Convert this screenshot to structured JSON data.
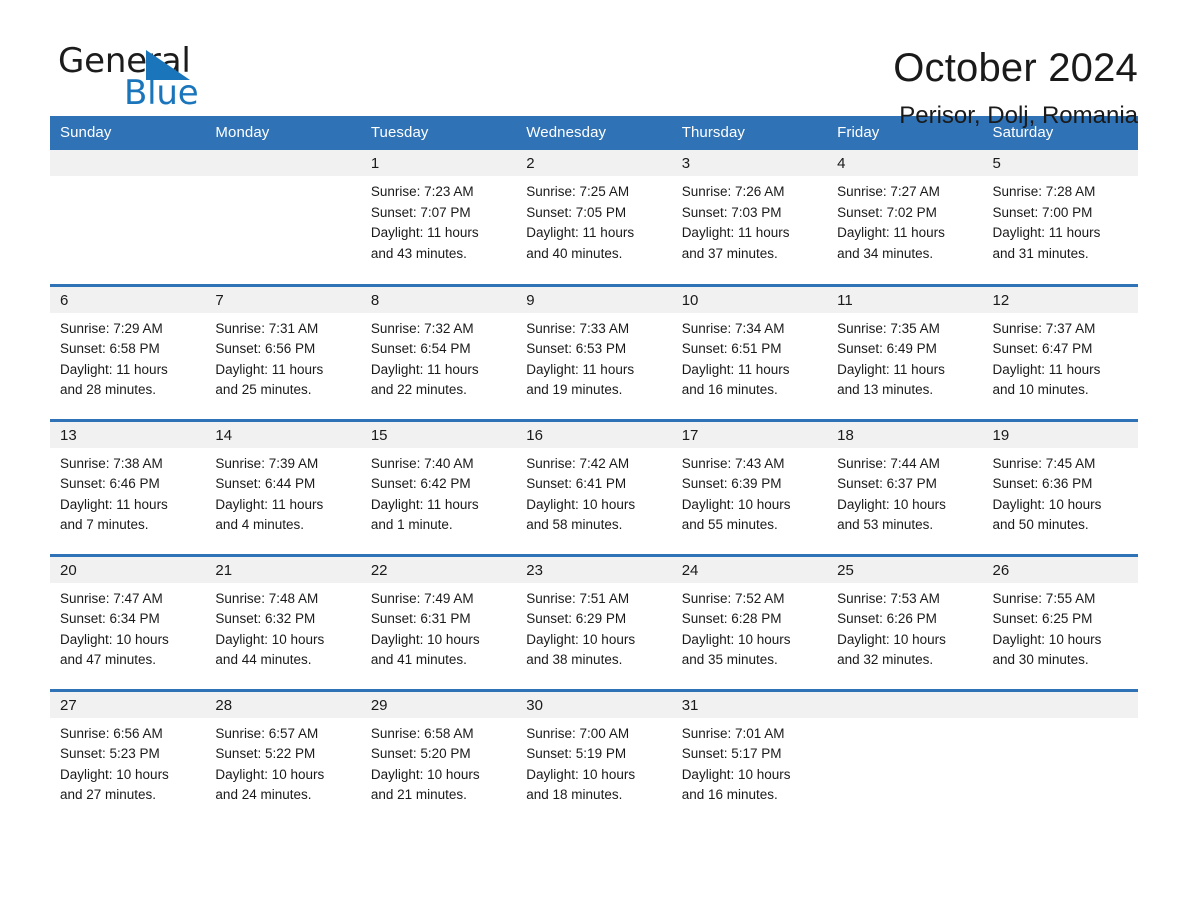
{
  "brand": {
    "name_part1": "General",
    "name_part2": "Blue",
    "logo_icon": "triangle-logo-icon",
    "accent_color": "#1b75bb"
  },
  "header": {
    "title": "October 2024",
    "subtitle": "Perisor, Dolj, Romania",
    "header_bg_color": "#2f72b5",
    "daynum_bg_color": "#f1f1f1"
  },
  "weekday_headers": [
    "Sunday",
    "Monday",
    "Tuesday",
    "Wednesday",
    "Thursday",
    "Friday",
    "Saturday"
  ],
  "labels": {
    "sunrise_prefix": "Sunrise:",
    "sunset_prefix": "Sunset:",
    "daylight_prefix": "Daylight:"
  },
  "weeks": [
    [
      {
        "day": "",
        "sunrise": "",
        "sunset": "",
        "daylight_line1": "",
        "daylight_line2": ""
      },
      {
        "day": "",
        "sunrise": "",
        "sunset": "",
        "daylight_line1": "",
        "daylight_line2": ""
      },
      {
        "day": "1",
        "sunrise": "Sunrise: 7:23 AM",
        "sunset": "Sunset: 7:07 PM",
        "daylight_line1": "Daylight: 11 hours",
        "daylight_line2": "and 43 minutes."
      },
      {
        "day": "2",
        "sunrise": "Sunrise: 7:25 AM",
        "sunset": "Sunset: 7:05 PM",
        "daylight_line1": "Daylight: 11 hours",
        "daylight_line2": "and 40 minutes."
      },
      {
        "day": "3",
        "sunrise": "Sunrise: 7:26 AM",
        "sunset": "Sunset: 7:03 PM",
        "daylight_line1": "Daylight: 11 hours",
        "daylight_line2": "and 37 minutes."
      },
      {
        "day": "4",
        "sunrise": "Sunrise: 7:27 AM",
        "sunset": "Sunset: 7:02 PM",
        "daylight_line1": "Daylight: 11 hours",
        "daylight_line2": "and 34 minutes."
      },
      {
        "day": "5",
        "sunrise": "Sunrise: 7:28 AM",
        "sunset": "Sunset: 7:00 PM",
        "daylight_line1": "Daylight: 11 hours",
        "daylight_line2": "and 31 minutes."
      }
    ],
    [
      {
        "day": "6",
        "sunrise": "Sunrise: 7:29 AM",
        "sunset": "Sunset: 6:58 PM",
        "daylight_line1": "Daylight: 11 hours",
        "daylight_line2": "and 28 minutes."
      },
      {
        "day": "7",
        "sunrise": "Sunrise: 7:31 AM",
        "sunset": "Sunset: 6:56 PM",
        "daylight_line1": "Daylight: 11 hours",
        "daylight_line2": "and 25 minutes."
      },
      {
        "day": "8",
        "sunrise": "Sunrise: 7:32 AM",
        "sunset": "Sunset: 6:54 PM",
        "daylight_line1": "Daylight: 11 hours",
        "daylight_line2": "and 22 minutes."
      },
      {
        "day": "9",
        "sunrise": "Sunrise: 7:33 AM",
        "sunset": "Sunset: 6:53 PM",
        "daylight_line1": "Daylight: 11 hours",
        "daylight_line2": "and 19 minutes."
      },
      {
        "day": "10",
        "sunrise": "Sunrise: 7:34 AM",
        "sunset": "Sunset: 6:51 PM",
        "daylight_line1": "Daylight: 11 hours",
        "daylight_line2": "and 16 minutes."
      },
      {
        "day": "11",
        "sunrise": "Sunrise: 7:35 AM",
        "sunset": "Sunset: 6:49 PM",
        "daylight_line1": "Daylight: 11 hours",
        "daylight_line2": "and 13 minutes."
      },
      {
        "day": "12",
        "sunrise": "Sunrise: 7:37 AM",
        "sunset": "Sunset: 6:47 PM",
        "daylight_line1": "Daylight: 11 hours",
        "daylight_line2": "and 10 minutes."
      }
    ],
    [
      {
        "day": "13",
        "sunrise": "Sunrise: 7:38 AM",
        "sunset": "Sunset: 6:46 PM",
        "daylight_line1": "Daylight: 11 hours",
        "daylight_line2": "and 7 minutes."
      },
      {
        "day": "14",
        "sunrise": "Sunrise: 7:39 AM",
        "sunset": "Sunset: 6:44 PM",
        "daylight_line1": "Daylight: 11 hours",
        "daylight_line2": "and 4 minutes."
      },
      {
        "day": "15",
        "sunrise": "Sunrise: 7:40 AM",
        "sunset": "Sunset: 6:42 PM",
        "daylight_line1": "Daylight: 11 hours",
        "daylight_line2": "and 1 minute."
      },
      {
        "day": "16",
        "sunrise": "Sunrise: 7:42 AM",
        "sunset": "Sunset: 6:41 PM",
        "daylight_line1": "Daylight: 10 hours",
        "daylight_line2": "and 58 minutes."
      },
      {
        "day": "17",
        "sunrise": "Sunrise: 7:43 AM",
        "sunset": "Sunset: 6:39 PM",
        "daylight_line1": "Daylight: 10 hours",
        "daylight_line2": "and 55 minutes."
      },
      {
        "day": "18",
        "sunrise": "Sunrise: 7:44 AM",
        "sunset": "Sunset: 6:37 PM",
        "daylight_line1": "Daylight: 10 hours",
        "daylight_line2": "and 53 minutes."
      },
      {
        "day": "19",
        "sunrise": "Sunrise: 7:45 AM",
        "sunset": "Sunset: 6:36 PM",
        "daylight_line1": "Daylight: 10 hours",
        "daylight_line2": "and 50 minutes."
      }
    ],
    [
      {
        "day": "20",
        "sunrise": "Sunrise: 7:47 AM",
        "sunset": "Sunset: 6:34 PM",
        "daylight_line1": "Daylight: 10 hours",
        "daylight_line2": "and 47 minutes."
      },
      {
        "day": "21",
        "sunrise": "Sunrise: 7:48 AM",
        "sunset": "Sunset: 6:32 PM",
        "daylight_line1": "Daylight: 10 hours",
        "daylight_line2": "and 44 minutes."
      },
      {
        "day": "22",
        "sunrise": "Sunrise: 7:49 AM",
        "sunset": "Sunset: 6:31 PM",
        "daylight_line1": "Daylight: 10 hours",
        "daylight_line2": "and 41 minutes."
      },
      {
        "day": "23",
        "sunrise": "Sunrise: 7:51 AM",
        "sunset": "Sunset: 6:29 PM",
        "daylight_line1": "Daylight: 10 hours",
        "daylight_line2": "and 38 minutes."
      },
      {
        "day": "24",
        "sunrise": "Sunrise: 7:52 AM",
        "sunset": "Sunset: 6:28 PM",
        "daylight_line1": "Daylight: 10 hours",
        "daylight_line2": "and 35 minutes."
      },
      {
        "day": "25",
        "sunrise": "Sunrise: 7:53 AM",
        "sunset": "Sunset: 6:26 PM",
        "daylight_line1": "Daylight: 10 hours",
        "daylight_line2": "and 32 minutes."
      },
      {
        "day": "26",
        "sunrise": "Sunrise: 7:55 AM",
        "sunset": "Sunset: 6:25 PM",
        "daylight_line1": "Daylight: 10 hours",
        "daylight_line2": "and 30 minutes."
      }
    ],
    [
      {
        "day": "27",
        "sunrise": "Sunrise: 6:56 AM",
        "sunset": "Sunset: 5:23 PM",
        "daylight_line1": "Daylight: 10 hours",
        "daylight_line2": "and 27 minutes."
      },
      {
        "day": "28",
        "sunrise": "Sunrise: 6:57 AM",
        "sunset": "Sunset: 5:22 PM",
        "daylight_line1": "Daylight: 10 hours",
        "daylight_line2": "and 24 minutes."
      },
      {
        "day": "29",
        "sunrise": "Sunrise: 6:58 AM",
        "sunset": "Sunset: 5:20 PM",
        "daylight_line1": "Daylight: 10 hours",
        "daylight_line2": "and 21 minutes."
      },
      {
        "day": "30",
        "sunrise": "Sunrise: 7:00 AM",
        "sunset": "Sunset: 5:19 PM",
        "daylight_line1": "Daylight: 10 hours",
        "daylight_line2": "and 18 minutes."
      },
      {
        "day": "31",
        "sunrise": "Sunrise: 7:01 AM",
        "sunset": "Sunset: 5:17 PM",
        "daylight_line1": "Daylight: 10 hours",
        "daylight_line2": "and 16 minutes."
      },
      {
        "day": "",
        "sunrise": "",
        "sunset": "",
        "daylight_line1": "",
        "daylight_line2": ""
      },
      {
        "day": "",
        "sunrise": "",
        "sunset": "",
        "daylight_line1": "",
        "daylight_line2": ""
      }
    ]
  ]
}
